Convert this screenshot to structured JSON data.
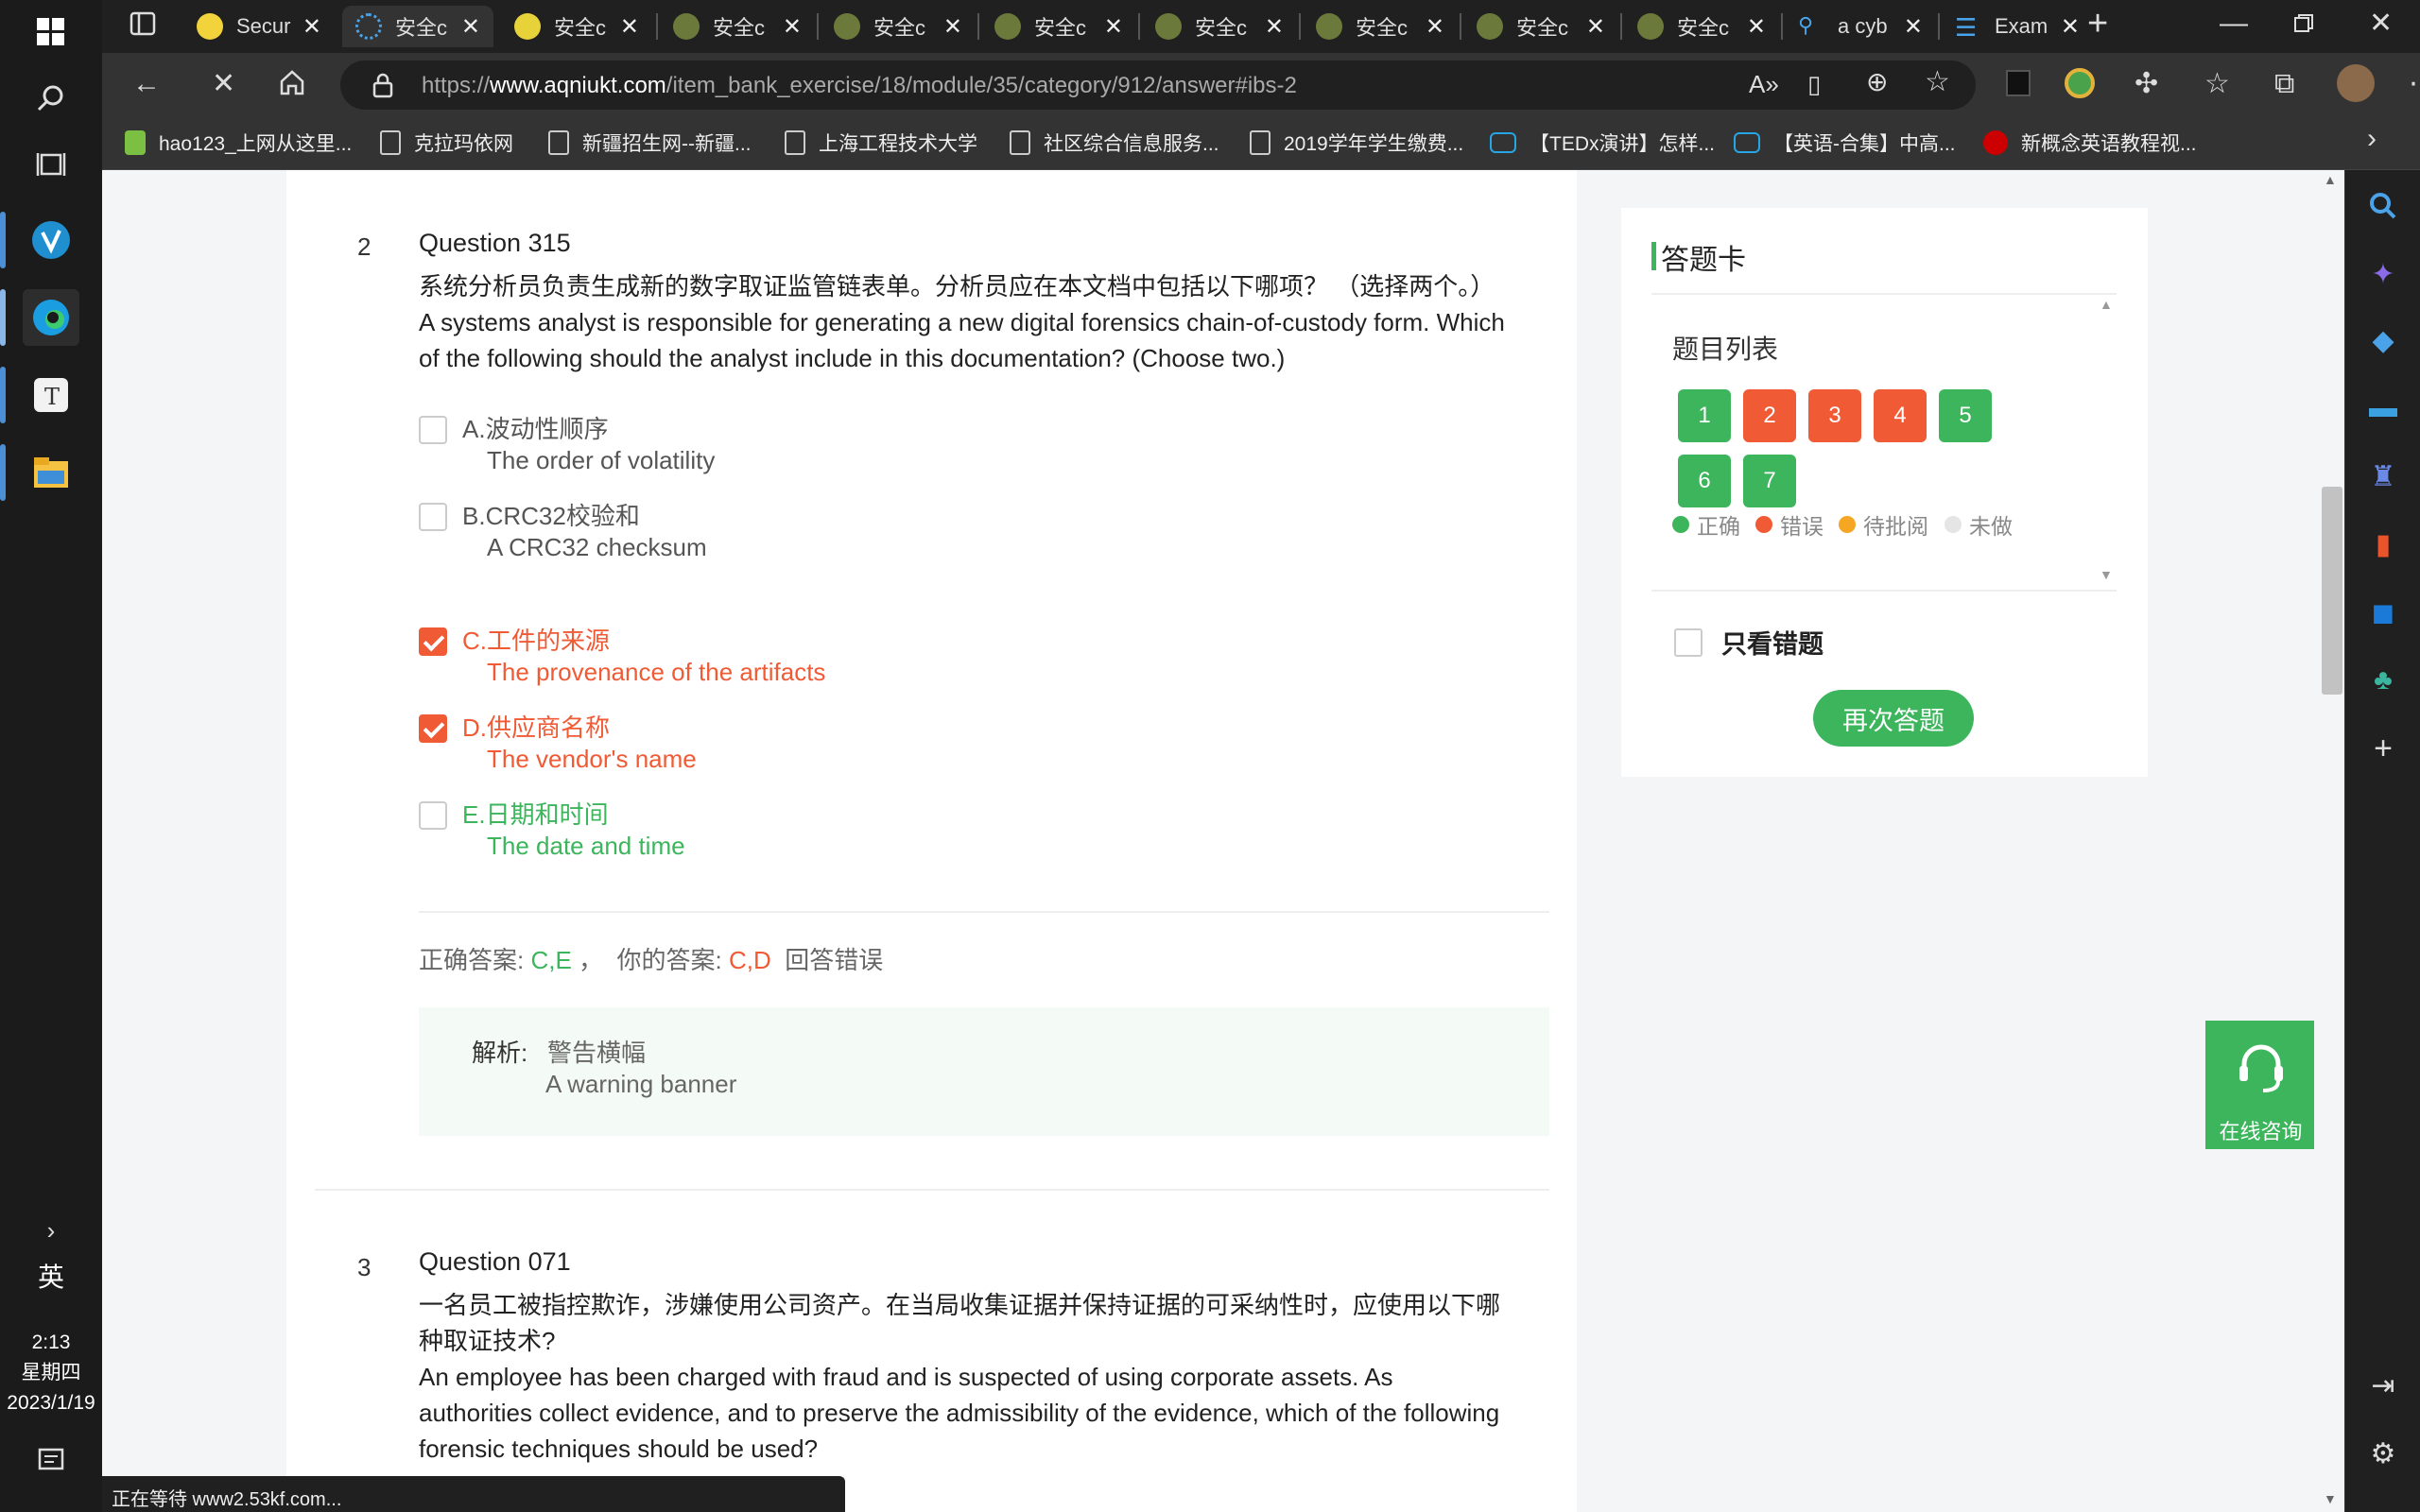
{
  "taskbar": {
    "ime": "英",
    "time": "2:13",
    "weekday": "星期四",
    "date": "2023/1/19"
  },
  "tabs": [
    {
      "label": "Secur"
    },
    {
      "label": "安全c"
    },
    {
      "label": "安全c"
    },
    {
      "label": "安全c"
    },
    {
      "label": "安全c"
    },
    {
      "label": "安全c"
    },
    {
      "label": "安全c"
    },
    {
      "label": "安全c"
    },
    {
      "label": "安全c"
    },
    {
      "label": "安全c"
    },
    {
      "label": "a cyb"
    },
    {
      "label": "Exam"
    }
  ],
  "address": {
    "prefix": "https://",
    "host": "www.aqniukt.com",
    "path": "/item_bank_exercise/18/module/35/category/912/answer#ibs-2"
  },
  "bookmarks": [
    {
      "label": "hao123_上网从这里..."
    },
    {
      "label": "克拉玛依网"
    },
    {
      "label": "新疆招生网--新疆..."
    },
    {
      "label": "上海工程技术大学"
    },
    {
      "label": "社区综合信息服务..."
    },
    {
      "label": "2019学年学生缴费..."
    },
    {
      "label": "【TEDx演讲】怎样..."
    },
    {
      "label": "【英语-合集】中高..."
    },
    {
      "label": "新概念英语教程视..."
    }
  ],
  "question2": {
    "number": "2",
    "title": "Question 315",
    "text_cn": "系统分析员负责生成新的数字取证监管链表单。分析员应在本文档中包括以下哪项？ （选择两个。）",
    "text_en_1": "A systems analyst is responsible for generating a new digital forensics chain-of-custody form. Which",
    "text_en_2": "of the following should the analyst include in this documentation? (Choose two.)",
    "options": [
      {
        "cn": "A.波动性顺序",
        "en": "The order of volatility",
        "state": "normal",
        "checked": false
      },
      {
        "cn": "B.CRC32校验和",
        "en": "A CRC32 checksum",
        "state": "normal",
        "checked": false
      },
      {
        "cn": "C.工件的来源",
        "en": "The provenance of the artifacts",
        "state": "wrong",
        "checked": true
      },
      {
        "cn": "D.供应商名称",
        "en": "The vendor's name",
        "state": "wrong",
        "checked": true
      },
      {
        "cn": "E.日期和时间",
        "en": "The date and time",
        "state": "right",
        "checked": false
      }
    ],
    "correct_label": "正确答案:",
    "correct_value": "C,E",
    "sep": "，",
    "yours_label": "你的答案:",
    "yours_value": "C,D",
    "result": "回答错误",
    "analysis_label": "解析:",
    "analysis_cn": "警告横幅",
    "analysis_en": "A warning banner"
  },
  "question3": {
    "number": "3",
    "title": "Question 071",
    "text_cn_1": "一名员工被指控欺诈，涉嫌使用公司资产。在当局收集证据并保持证据的可采纳性时，应使用以下哪",
    "text_cn_2": "种取证技术?",
    "text_en_1": "An employee has been charged with fraud and is suspected of using corporate assets. As",
    "text_en_2": "authorities collect evidence, and to preserve the admissibility of the evidence, which of the following",
    "text_en_3": "forensic techniques should be used?"
  },
  "card": {
    "title": "答题卡",
    "list_title": "题目列表",
    "items": [
      {
        "n": "1",
        "status": "green"
      },
      {
        "n": "2",
        "status": "red"
      },
      {
        "n": "3",
        "status": "red"
      },
      {
        "n": "4",
        "status": "red"
      },
      {
        "n": "5",
        "status": "green"
      },
      {
        "n": "6",
        "status": "green"
      },
      {
        "n": "7",
        "status": "green"
      }
    ],
    "legend": [
      {
        "label": "正确",
        "color": "#3cb55c"
      },
      {
        "label": "错误",
        "color": "#f05a35"
      },
      {
        "label": "待批阅",
        "color": "#f5a623"
      },
      {
        "label": "未做",
        "color": "#e5e5e5"
      }
    ],
    "wrong_only": "只看错题",
    "retry": "再次答题"
  },
  "consult": "在线咨询",
  "status": "正在等待 www2.53kf.com..."
}
